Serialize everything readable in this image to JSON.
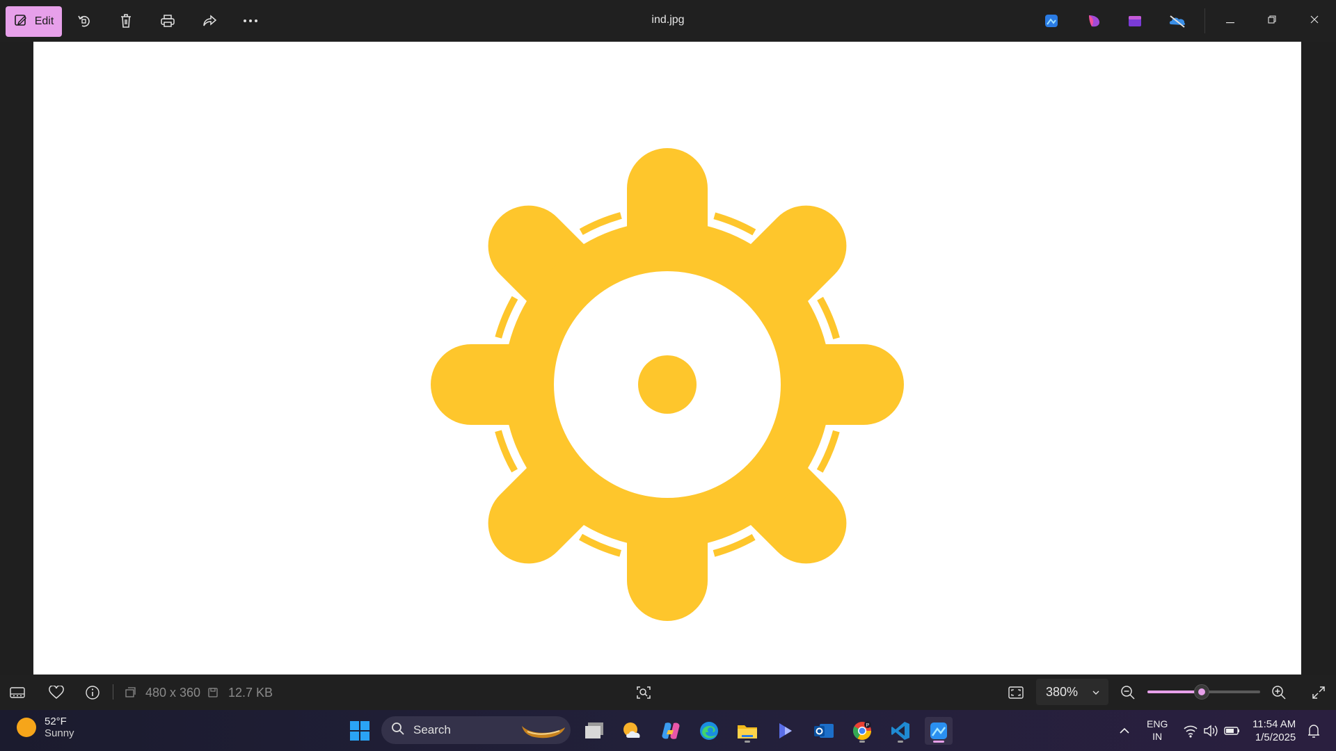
{
  "toolbar": {
    "edit_label": "Edit",
    "file_name": "ind.jpg"
  },
  "statusbar": {
    "dimensions": "480 x 360",
    "file_size": "12.7 KB",
    "zoom": "380%",
    "zoom_level_fraction": 0.48
  },
  "taskbar": {
    "weather_temp": "52°F",
    "weather_desc": "Sunny",
    "search_placeholder": "Search",
    "lang_line1": "ENG",
    "lang_line2": "IN",
    "time": "11:54 AM",
    "date": "1/5/2025"
  },
  "colors": {
    "accent": "#e7a0ea",
    "gear": "#fec62c",
    "canvas": "#ffffff"
  },
  "icons": {
    "toolbar": [
      "edit-icon",
      "rotate-icon",
      "delete-icon",
      "print-icon",
      "share-icon",
      "more-icon"
    ],
    "apps": [
      "photos-app-icon",
      "clipchamp-icon",
      "designer-icon",
      "onedrive-icon"
    ],
    "window": [
      "minimize-icon",
      "restore-icon",
      "close-icon"
    ]
  }
}
